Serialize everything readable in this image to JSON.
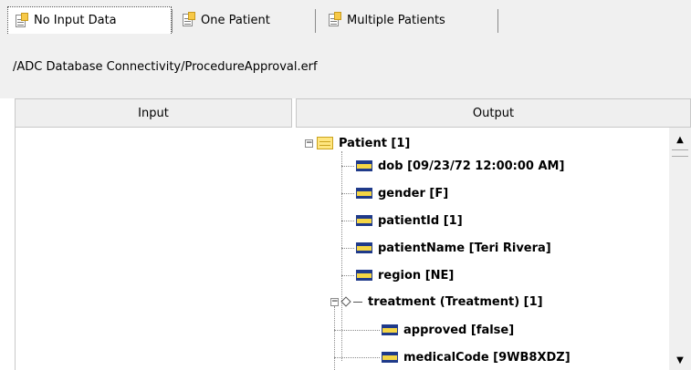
{
  "tabs": [
    {
      "label": "No Input Data",
      "icon": "document-icon",
      "active": true
    },
    {
      "label": "One Patient",
      "icon": "document-icon",
      "active": false
    },
    {
      "label": "Multiple Patients",
      "icon": "document-icon",
      "active": false
    }
  ],
  "path": "/ADC Database Connectivity/ProcedureApproval.erf",
  "columns": {
    "input": "Input",
    "output": "Output"
  },
  "tree": {
    "root": "Patient [1]",
    "fields": [
      "dob [09/23/72 12:00:00 AM]",
      "gender [F]",
      "patientId [1]",
      "patientName [Teri Rivera]",
      "region [NE]"
    ],
    "treatment": {
      "label": "treatment (Treatment) [1]",
      "fields": [
        "approved [false]",
        "medicalCode [9WB8XDZ]"
      ]
    }
  },
  "colors": {
    "tab_badge": "#f7c948",
    "field_icon": "#f4d544",
    "field_icon_border": "#1f3a8a"
  }
}
